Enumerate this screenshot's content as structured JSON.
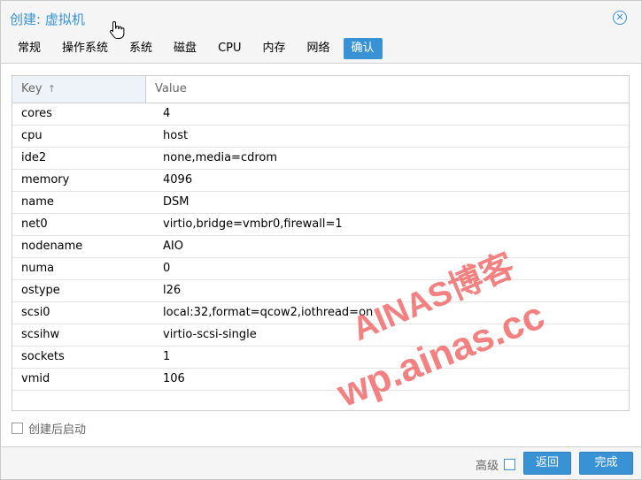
{
  "dialog": {
    "title": "创建: 虚拟机",
    "close_icon": "close-circle-icon"
  },
  "tabs": [
    {
      "label": "常规",
      "active": false
    },
    {
      "label": "操作系统",
      "active": false
    },
    {
      "label": "系统",
      "active": false
    },
    {
      "label": "磁盘",
      "active": false
    },
    {
      "label": "CPU",
      "active": false
    },
    {
      "label": "内存",
      "active": false
    },
    {
      "label": "网络",
      "active": false
    },
    {
      "label": "确认",
      "active": true
    }
  ],
  "grid": {
    "columns": {
      "key": "Key",
      "value": "Value",
      "sort_indicator": "↑"
    },
    "rows": [
      {
        "key": "cores",
        "value": "4"
      },
      {
        "key": "cpu",
        "value": "host"
      },
      {
        "key": "ide2",
        "value": "none,media=cdrom"
      },
      {
        "key": "memory",
        "value": "4096"
      },
      {
        "key": "name",
        "value": "DSM"
      },
      {
        "key": "net0",
        "value": "virtio,bridge=vmbr0,firewall=1"
      },
      {
        "key": "nodename",
        "value": "AIO"
      },
      {
        "key": "numa",
        "value": "0"
      },
      {
        "key": "ostype",
        "value": "l26"
      },
      {
        "key": "scsi0",
        "value": "local:32,format=qcow2,iothread=on"
      },
      {
        "key": "scsihw",
        "value": "virtio-scsi-single"
      },
      {
        "key": "sockets",
        "value": "1"
      },
      {
        "key": "vmid",
        "value": "106"
      }
    ]
  },
  "footer": {
    "start_after_create_label": "创建后启动",
    "start_after_create_checked": false,
    "advanced_label": "高级",
    "advanced_checked": false,
    "back_label": "返回",
    "finish_label": "完成"
  },
  "watermark": {
    "line1": "AINAS博客",
    "line2": "wp.ainas.cc"
  },
  "colors": {
    "accent": "#3892d4",
    "watermark": "#f05050"
  }
}
